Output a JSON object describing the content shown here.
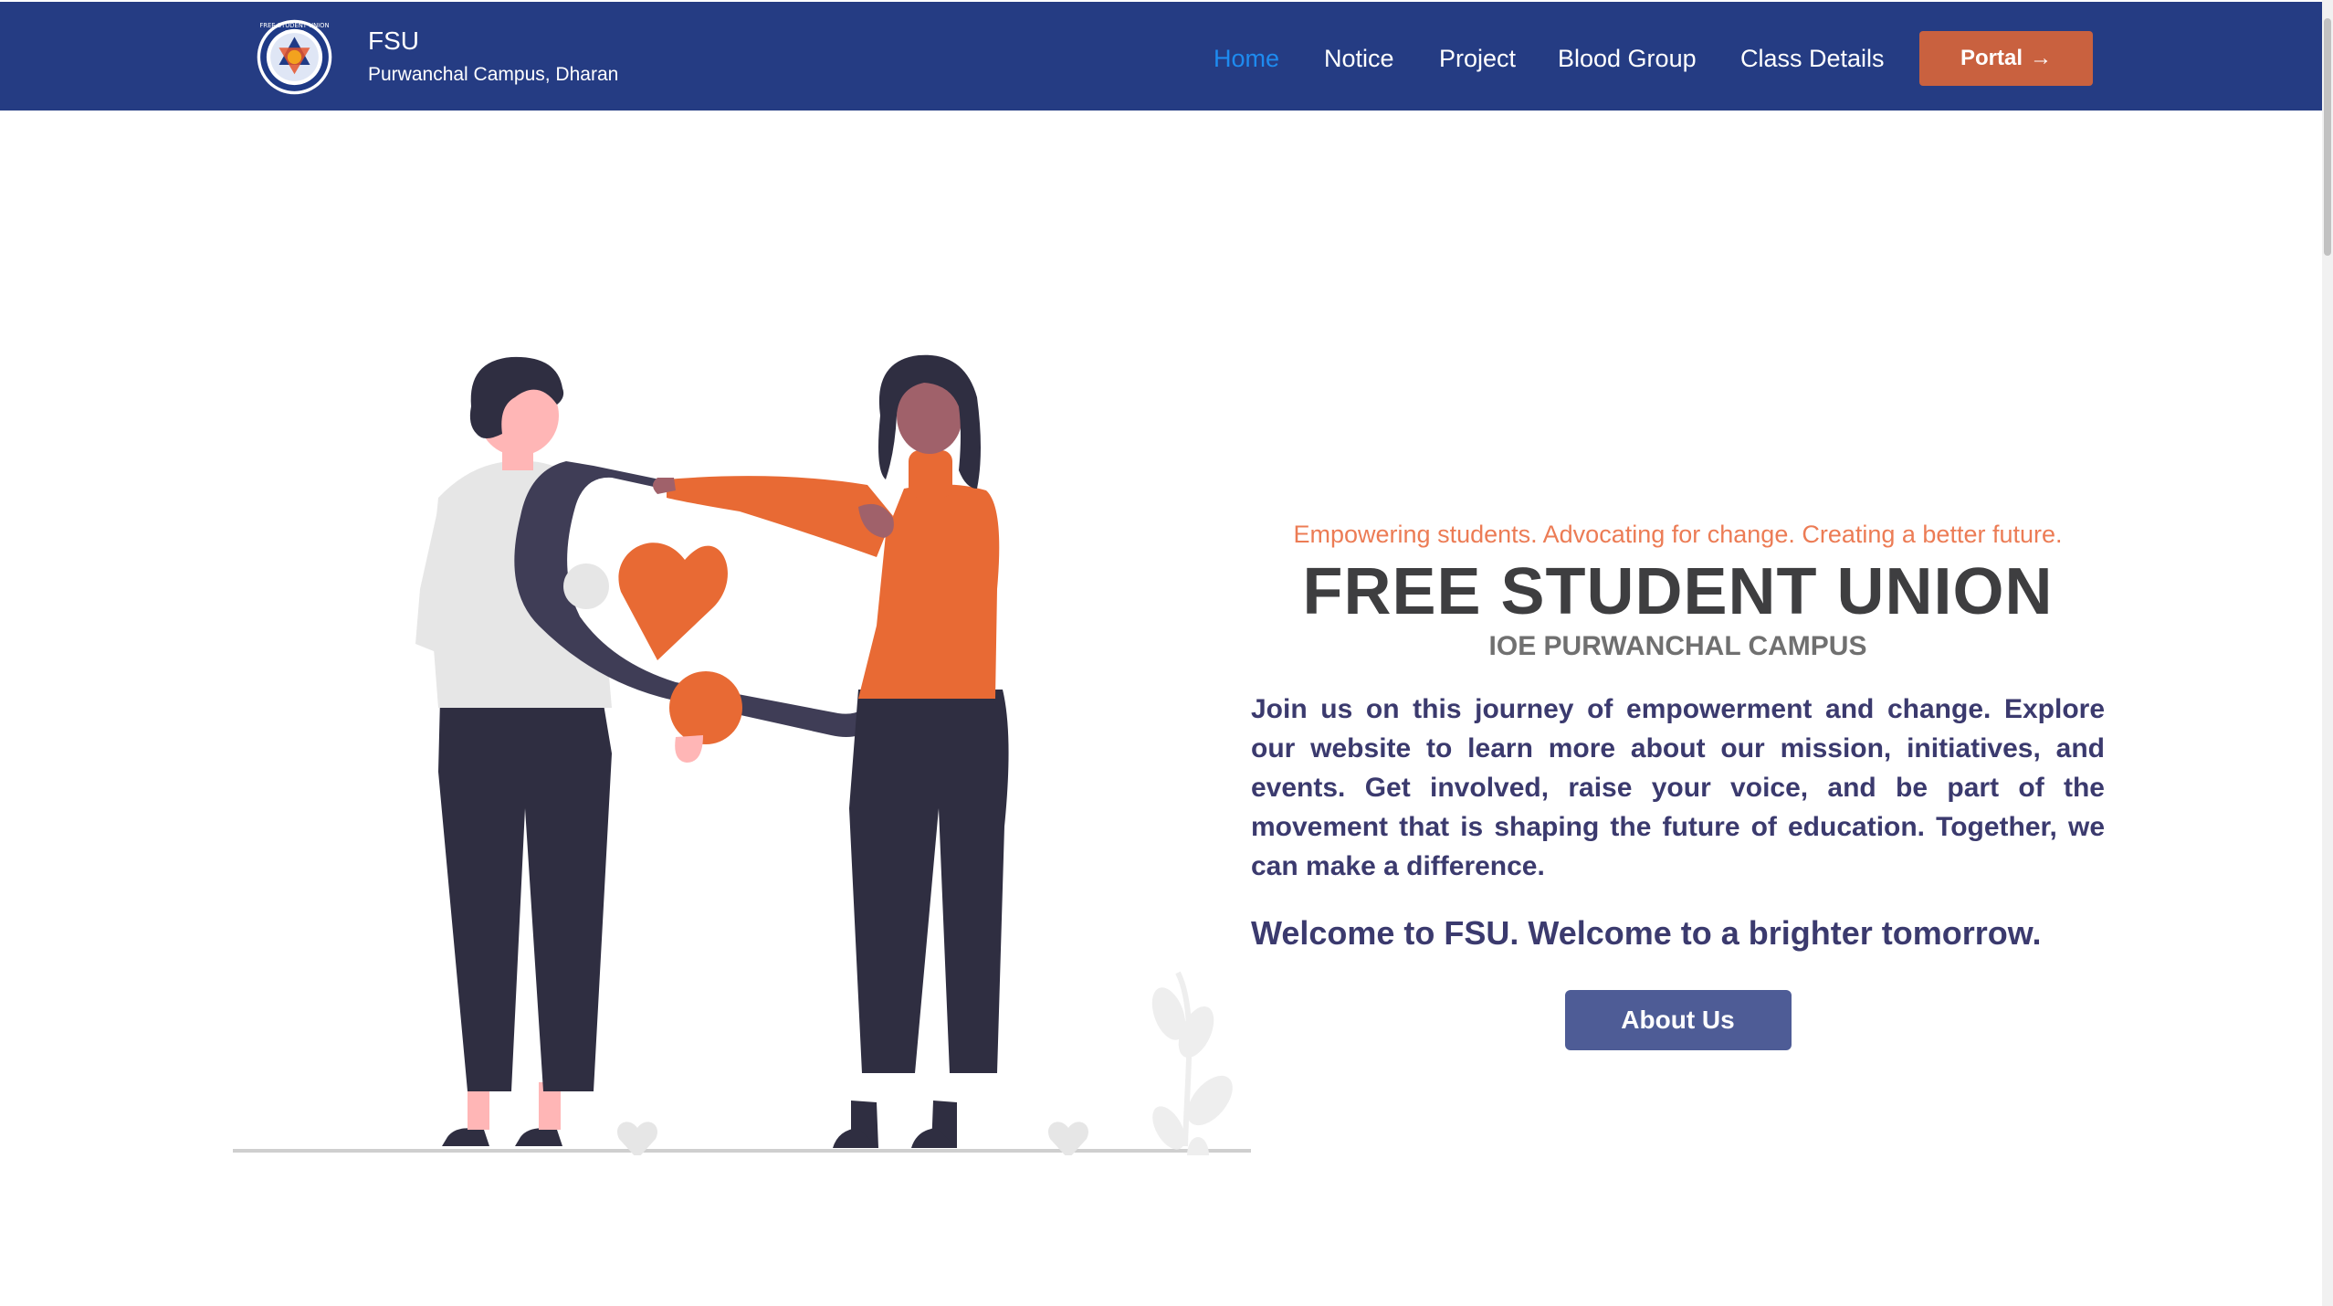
{
  "navbar": {
    "brand_title": "FSU",
    "brand_subtitle": "Purwanchal Campus, Dharan",
    "logo_icon": "fsu-logo-icon",
    "links": [
      {
        "label": "Home",
        "active": true
      },
      {
        "label": "Notice",
        "active": false
      },
      {
        "label": "Project",
        "active": false
      },
      {
        "label": "Blood Group",
        "active": false
      },
      {
        "label": "Class Details",
        "active": false
      }
    ],
    "portal_label": "Portal",
    "portal_icon": "arrow-right-icon"
  },
  "hero": {
    "tagline": "Empowering students. Advocating for change. Creating a better future.",
    "title": "FREE STUDENT UNION",
    "subtitle": "IOE PURWANCHAL CAMPUS",
    "description": "Join us on this journey of empowerment and change. Explore our website to learn more about our mission, initiatives, and events. Get involved, raise your voice, and be part of the movement that is shaping the future of education. Together, we can make a difference.",
    "welcome": "Welcome to FSU. Welcome to a brighter tomorrow.",
    "about_button": "About Us"
  },
  "colors": {
    "nav_bg": "#253c83",
    "nav_active": "#1e8bf0",
    "portal_bg": "#c9613f",
    "tagline": "#ec7c55",
    "title": "#3e3e40",
    "description": "#3b3a6e",
    "about_bg": "#4e5c96",
    "accent_orange": "#e86a34"
  }
}
